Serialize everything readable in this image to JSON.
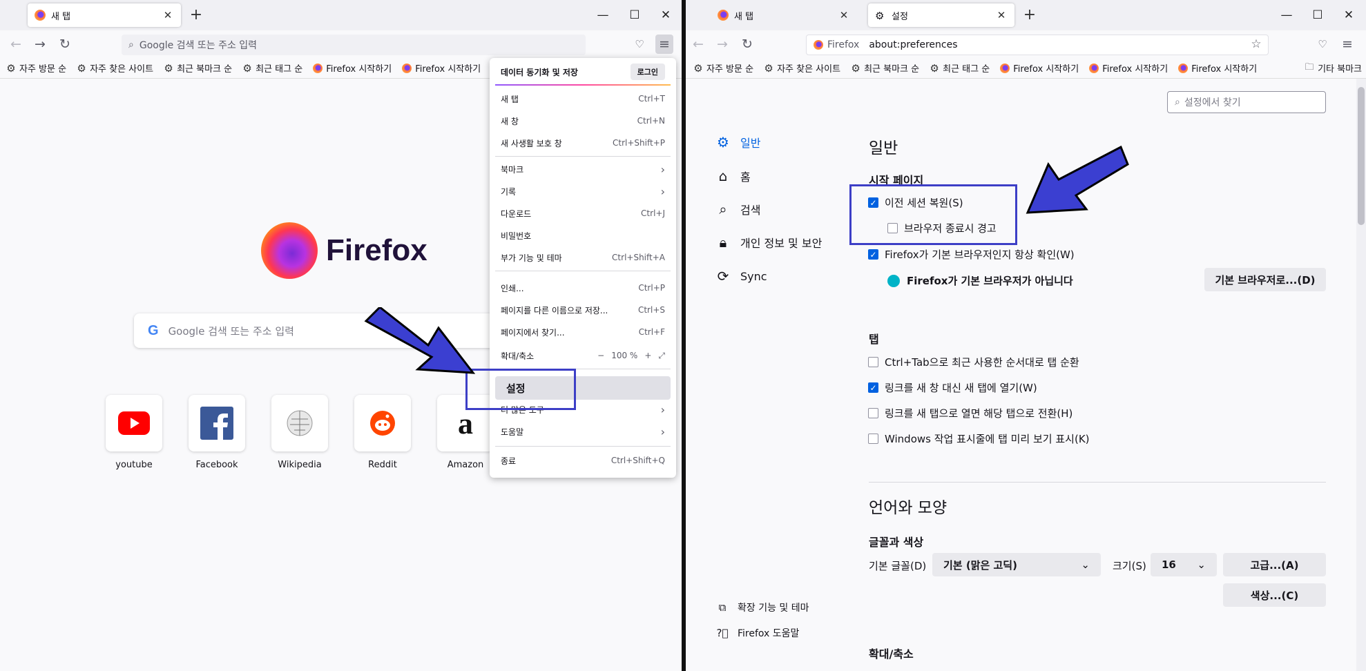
{
  "left": {
    "tab_title": "새 탭",
    "url_placeholder": "Google 검색 또는 주소 입력",
    "bookmarks": [
      "자주 방문 순",
      "자주 찾은 사이트",
      "최근 북마크 순",
      "최근 태그 순",
      "Firefox 시작하기",
      "Firefox 시작하기"
    ],
    "logo_text": "Firefox",
    "search_placeholder": "Google 검색 또는 주소 입력",
    "tiles": [
      "youtube",
      "Facebook",
      "Wikipedia",
      "Reddit",
      "Amazon"
    ]
  },
  "menu": {
    "sync_title": "데이터 동기화 및 저장",
    "login": "로그인",
    "items": [
      {
        "label": "새 탭",
        "shortcut": "Ctrl+T"
      },
      {
        "label": "새 창",
        "shortcut": "Ctrl+N"
      },
      {
        "label": "새 사생활 보호 창",
        "shortcut": "Ctrl+Shift+P"
      },
      {
        "label": "북마크",
        "shortcut": "›"
      },
      {
        "label": "기록",
        "shortcut": "›"
      },
      {
        "label": "다운로드",
        "shortcut": "Ctrl+J"
      },
      {
        "label": "비밀번호",
        "shortcut": ""
      },
      {
        "label": "부가 기능 및 테마",
        "shortcut": "Ctrl+Shift+A"
      },
      {
        "label": "인쇄...",
        "shortcut": "Ctrl+P"
      },
      {
        "label": "페이지를 다른 이름으로 저장...",
        "shortcut": "Ctrl+S"
      },
      {
        "label": "페이지에서 찾기...",
        "shortcut": "Ctrl+F"
      },
      {
        "label": "확대/축소",
        "shortcut": "100 %"
      },
      {
        "label": "설정",
        "shortcut": ""
      },
      {
        "label": "더 많은 도구",
        "shortcut": "›"
      },
      {
        "label": "도움말",
        "shortcut": "›"
      },
      {
        "label": "종료",
        "shortcut": "Ctrl+Shift+Q"
      }
    ]
  },
  "right": {
    "tab1_title": "새 탭",
    "tab2_title": "설정",
    "url_label": "Firefox",
    "url": "about:preferences",
    "bookmarks": [
      "자주 방문 순",
      "자주 찾은 사이트",
      "최근 북마크 순",
      "최근 태그 순",
      "Firefox 시작하기",
      "Firefox 시작하기",
      "Firefox 시작하기"
    ],
    "other_bookmarks": "기타 북마크",
    "search_placeholder": "설정에서 찾기",
    "sidebar": [
      "일반",
      "홈",
      "검색",
      "개인 정보 및 보안",
      "Sync"
    ],
    "sidebar_bottom": [
      "확장 기능 및 테마",
      "Firefox 도움말"
    ],
    "general_title": "일반",
    "startup_title": "시작 페이지",
    "restore_session": "이전 세션 복원(S)",
    "warn_quit": "브라우저 종료시 경고",
    "check_default": "Firefox가 기본 브라우저인지 항상 확인(W)",
    "not_default": "Firefox가 기본 브라우저가 아닙니다",
    "make_default": "기본 브라우저로...(D)",
    "tabs_title": "탭",
    "tab_opts": [
      "Ctrl+Tab으로 최근 사용한 순서대로 탭 순환",
      "링크를 새 창 대신 새 탭에 열기(W)",
      "링크를 새 탭으로 열면 해당 탭으로 전환(H)",
      "Windows 작업 표시줄에 탭 미리 보기 표시(K)"
    ],
    "lang_title": "언어와 모양",
    "fonts_title": "글꼴과 색상",
    "default_font_label": "기본 글꼴(D)",
    "default_font": "기본 (맑은 고딕)",
    "size_label": "크기(S)",
    "size": "16",
    "advanced": "고급...(A)",
    "colors": "색상...(C)",
    "zoom_title": "확대/축소"
  },
  "colors": {
    "accent": "#0061e0",
    "highlight": "#3d3fc6",
    "arrow": "#3b3fd1"
  }
}
